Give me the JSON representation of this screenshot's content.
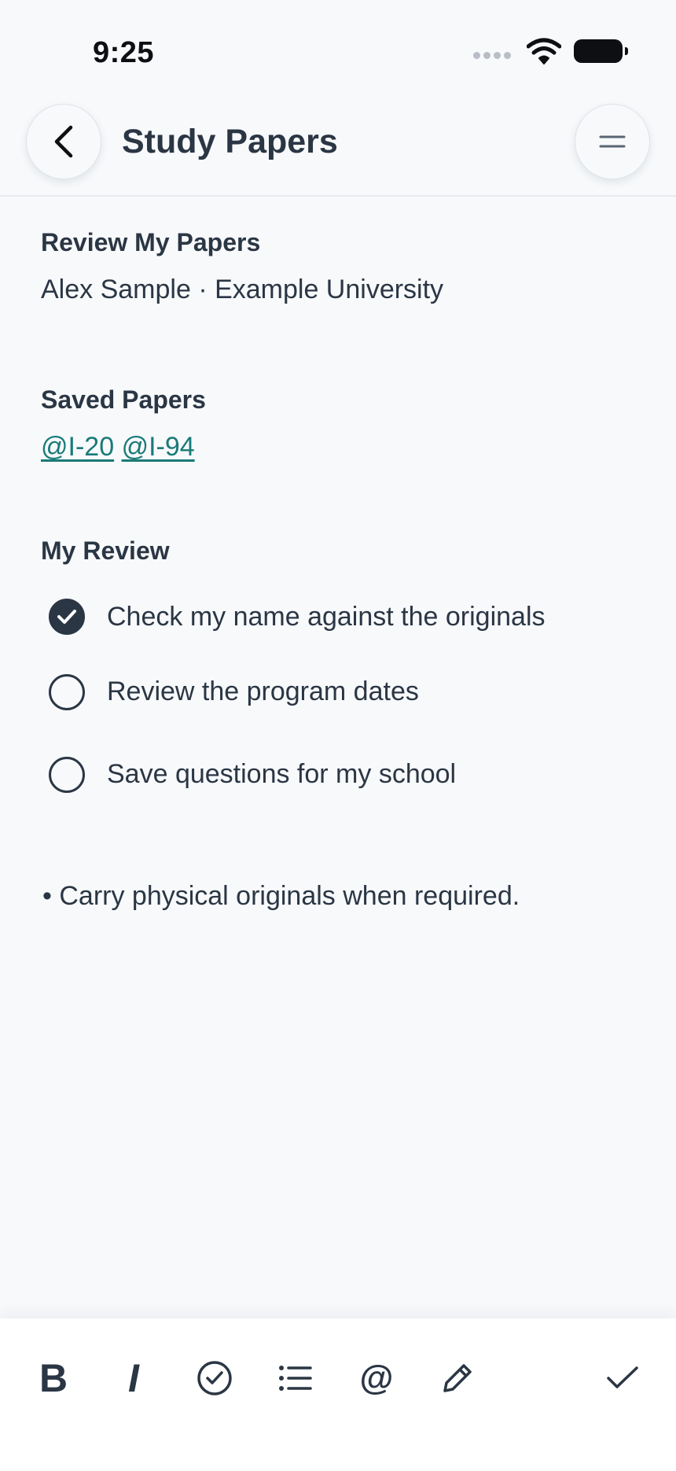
{
  "status_bar": {
    "time": "9:25"
  },
  "header": {
    "title": "Study Papers"
  },
  "profile": {
    "heading": "Review My Papers",
    "subtitle": "Alex Sample · Example University"
  },
  "saved": {
    "heading": "Saved Papers",
    "links": [
      "@I-20",
      "@I-94"
    ]
  },
  "review": {
    "heading": "My Review",
    "items": [
      {
        "label": "Check my name against the originals",
        "checked": true
      },
      {
        "label": "Review the program dates",
        "checked": false
      },
      {
        "label": "Save questions for my school",
        "checked": false
      }
    ]
  },
  "note": "• Carry physical originals when required.",
  "toolbar": {
    "bold_label": "B",
    "italic_label": "I",
    "mention_label": "@"
  },
  "colors": {
    "text": "#2b3644",
    "link": "#1a7a78",
    "background": "#f7f9fb"
  },
  "icons": [
    "back-arrow-icon",
    "menu-icon",
    "checkbox-checked-icon",
    "checkbox-empty-icon",
    "check-circle-icon",
    "list-icon",
    "pencil-icon",
    "checkmark-icon",
    "wifi-icon",
    "battery-icon"
  ]
}
